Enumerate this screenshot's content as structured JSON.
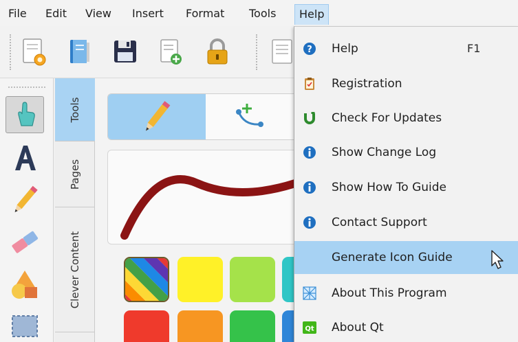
{
  "menubar": {
    "items": [
      {
        "label": "File"
      },
      {
        "label": "Edit"
      },
      {
        "label": "View"
      },
      {
        "label": "Insert"
      },
      {
        "label": "Format"
      },
      {
        "label": "Tools"
      },
      {
        "label": "Help"
      }
    ],
    "active": "Help"
  },
  "toolbar": {
    "icons": [
      "new-document-icon",
      "open-book-icon",
      "save-floppy-icon",
      "add-page-icon",
      "lock-icon",
      "document-icon"
    ]
  },
  "toolstrip": {
    "tools": [
      "hand-pointer-icon",
      "text-a-icon",
      "pencil-icon",
      "eraser-icon",
      "shapes-icon",
      "selection-icon"
    ],
    "selected": "hand-pointer-icon"
  },
  "side_tabs": {
    "items": [
      {
        "label": "Tools"
      },
      {
        "label": "Pages"
      },
      {
        "label": "Clever Content"
      }
    ],
    "active": "Tools"
  },
  "canvas": {
    "modes": [
      "pencil-mode-icon",
      "curve-add-mode-icon"
    ],
    "stroke_color": "#8b1414",
    "swatches": [
      "rainbow",
      "#fff128",
      "#a5e24a",
      "#30c6c6",
      "#ef3a2c",
      "#f79622",
      "#35c24a",
      "#2f86d8"
    ]
  },
  "help_menu": {
    "items": [
      {
        "label": "Help",
        "shortcut": "F1",
        "icon": "question-icon"
      },
      {
        "label": "Registration",
        "icon": "clipboard-icon"
      },
      {
        "label": "Check For Updates",
        "icon": "update-u-icon"
      },
      {
        "label": "Show Change Log",
        "icon": "info-icon"
      },
      {
        "label": "Show How To Guide",
        "icon": "info-icon"
      },
      {
        "label": "Contact Support",
        "icon": "info-icon"
      },
      {
        "label": "Generate Icon Guide",
        "icon": ""
      },
      {
        "label": "About This Program",
        "icon": "network-grid-icon"
      },
      {
        "label": "About Qt",
        "icon": "qt-logo-icon",
        "icon_text": "Qt"
      }
    ],
    "highlighted": "Generate Icon Guide"
  },
  "colors": {
    "menu_highlight": "#a7d2f3",
    "info_blue": "#1f6fc0",
    "update_green": "#2e8b2e",
    "qt_green": "#41b618"
  }
}
